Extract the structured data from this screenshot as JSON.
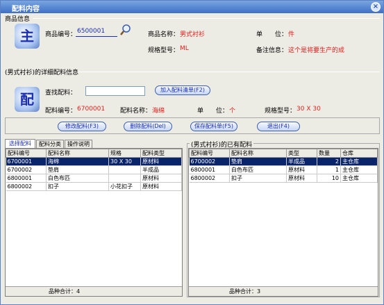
{
  "window": {
    "title": "配料内容",
    "close": "×"
  },
  "product": {
    "section_title": "商品信息",
    "logo_char": "主",
    "code_label": "商品编号：",
    "code_value": "6500001",
    "name_label": "商品名称：",
    "name_value": "男式衬衫",
    "unit_label": "单　　位：",
    "unit_value": "件",
    "spec_label": "规格型号：",
    "spec_value": "ML",
    "note_label": "备注信息：",
    "note_value": "这个是将要生产的成"
  },
  "detail": {
    "section_title": "(男式衬衫)的详细配料信息",
    "logo_char": "配",
    "search_label": "查找配料：",
    "search_value": "",
    "add_button": "加入配料清单(F2)",
    "code_label": "配料编号：",
    "code_value": "6700001",
    "name_label": "配料名称：",
    "name_value": "海绵",
    "unit_label": "单　　位：",
    "unit_value": "个",
    "spec_label": "规格型号：",
    "spec_value": "30 X 30"
  },
  "toolbar": {
    "modify": "修改配料(F3)",
    "delete": "删除配料(Del)",
    "save": "保存配料单(F5)",
    "exit": "退出(F4)"
  },
  "left_panel": {
    "tabs": [
      "选择配料",
      "配料分类",
      "操作说明"
    ],
    "columns": [
      "配料编号",
      "配料名称",
      "规格",
      "配料类型"
    ],
    "rows": [
      [
        "6700001",
        "海绵",
        "30 X 30",
        "原材料"
      ],
      [
        "6700002",
        "垫肩",
        "",
        "半成品"
      ],
      [
        "6800001",
        "白色布匹",
        "",
        "原材料"
      ],
      [
        "6800002",
        "扣子",
        "小花扣子",
        "原材料"
      ]
    ],
    "footer": "品种合计：4"
  },
  "right_panel": {
    "title": "(男式衬衫)的已有配料",
    "columns": [
      "配料编号",
      "配料名称",
      "类型",
      "数量",
      "仓库"
    ],
    "rows": [
      [
        "6700002",
        "垫肩",
        "半成品",
        "2",
        "主仓库"
      ],
      [
        "6800001",
        "白色布匹",
        "原材料",
        "1",
        "主仓库"
      ],
      [
        "6800002",
        "扣子",
        "原材料",
        "10",
        "主仓库"
      ]
    ],
    "footer": "品种合计：3"
  }
}
